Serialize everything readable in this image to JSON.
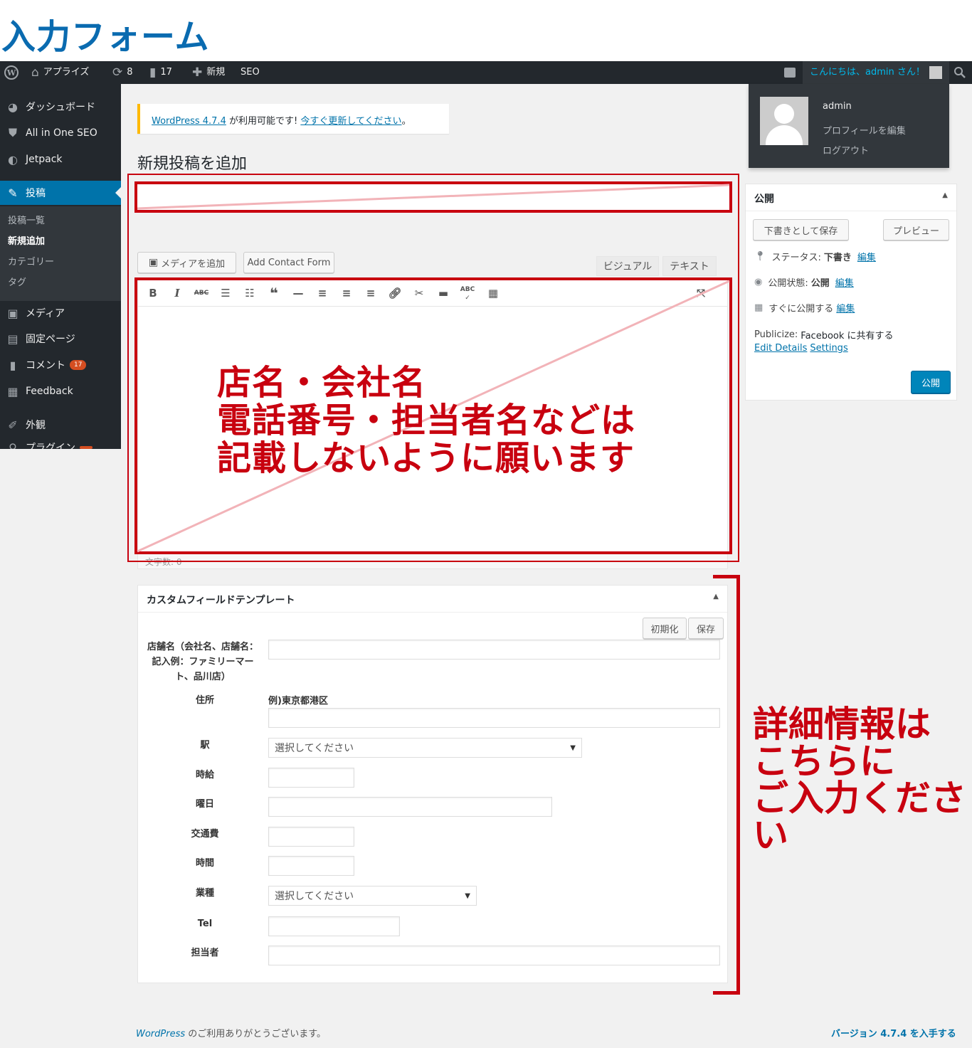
{
  "heading": "入力フォーム",
  "adminbar": {
    "site_name": "アプライズ",
    "updates_count": "8",
    "comments_count": "17",
    "new_label": "新規",
    "seo_label": "SEO",
    "greeting": "こんにちは、admin さん！"
  },
  "sidebar": {
    "items": [
      {
        "label": "ダッシュボード",
        "icon": "dashboard-icon"
      },
      {
        "label": "All in One SEO",
        "icon": "shield-icon"
      },
      {
        "label": "Jetpack",
        "icon": "jetpack-icon"
      },
      {
        "label": "投稿",
        "icon": "pin-icon"
      },
      {
        "label": "メディア",
        "icon": "media-icon"
      },
      {
        "label": "固定ページ",
        "icon": "page-icon"
      },
      {
        "label": "コメント",
        "icon": "comment-icon",
        "badge": "17"
      },
      {
        "label": "Feedback",
        "icon": "feedback-icon"
      },
      {
        "label": "外観",
        "icon": "brush-icon"
      },
      {
        "label": "プラグイン",
        "icon": "plugin-icon"
      }
    ],
    "submenu": [
      "投稿一覧",
      "新規追加",
      "カテゴリー",
      "タグ"
    ]
  },
  "notice": {
    "link1": "WordPress 4.7.4",
    "text": " が利用可能です! ",
    "link2": "今すぐ更新してください",
    "end": "。"
  },
  "page_title": "新規投稿を追加",
  "editor": {
    "add_media": "メディアを追加",
    "add_contact_form": "Add Contact Form",
    "tab_visual": "ビジュアル",
    "tab_text": "テキスト",
    "wordcount": "文字数: 0"
  },
  "annotation_editor": [
    "店名・会社名",
    "電話番号・担当者名などは",
    "記載しないように願います"
  ],
  "annotation_fields": [
    "詳細情報は",
    "こちらに",
    "ご入力ください"
  ],
  "user_menu": {
    "name": "admin",
    "edit_profile": "プロフィールを編集",
    "logout": "ログアウト"
  },
  "publish": {
    "title": "公開",
    "save_draft": "下書きとして保存",
    "preview": "プレビュー",
    "status_label": "ステータス:",
    "status_value": "下書き",
    "visibility_label": "公開状態:",
    "visibility_value": "公開",
    "schedule_label": "すぐに公開する",
    "edit": "編集",
    "publicize_label": "Publicize:",
    "publicize_value": "Facebook に共有する",
    "edit_details": "Edit Details",
    "settings": "Settings",
    "publish_button": "公開"
  },
  "custom_fields": {
    "title": "カスタムフィールドテンプレート",
    "reset": "初期化",
    "save": "保存",
    "fields": {
      "shop_name": "店舗名（会社名、店舗名：記入例：ファミリーマート、品川店）",
      "address": "住所",
      "address_hint": "例)東京都港区",
      "station": "駅",
      "station_select": "選択してください",
      "wage": "時給",
      "days": "曜日",
      "transport": "交通費",
      "hours": "時間",
      "industry": "業種",
      "industry_select": "選択してください",
      "tel": "Tel",
      "contact": "担当者"
    }
  },
  "footer": {
    "wp_link": "WordPress",
    "thanks": " のご利用ありがとうございます。",
    "version": "バージョン 4.7.4 を入手する"
  }
}
